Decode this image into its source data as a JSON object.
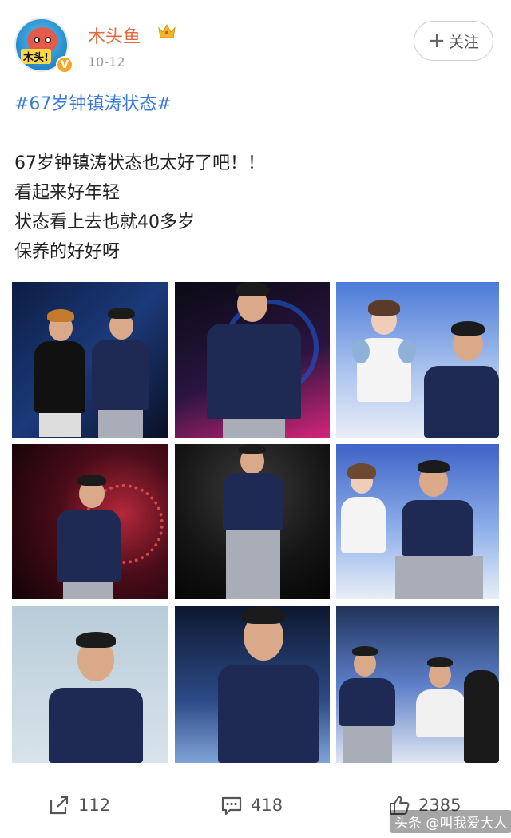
{
  "post": {
    "username": "木头鱼",
    "date": "10-12",
    "follow_label": "关注",
    "avatar_text": "木头!",
    "topic": "#67岁钟镇涛状态#",
    "content_lines": [
      "67岁钟镇涛状态也太好了吧！！",
      "看起来好年轻",
      "状态看上去也就40多岁",
      "保养的好好呀"
    ]
  },
  "photos": [
    {
      "name": "photo-1"
    },
    {
      "name": "photo-2"
    },
    {
      "name": "photo-3"
    },
    {
      "name": "photo-4"
    },
    {
      "name": "photo-5"
    },
    {
      "name": "photo-6"
    },
    {
      "name": "photo-7"
    },
    {
      "name": "photo-8"
    },
    {
      "name": "photo-9"
    }
  ],
  "actions": {
    "share_count": "112",
    "comment_count": "418",
    "like_count": "2385"
  },
  "watermark": "头条 @叫我爱大人",
  "icons": {
    "crown": "crown-icon",
    "verified": "verified-badge-icon",
    "share": "share-icon",
    "comment": "comment-icon",
    "like": "thumbs-up-icon"
  },
  "colors": {
    "username": "#e3683d",
    "topic": "#3a7bd5",
    "verified": "#f6a623"
  }
}
